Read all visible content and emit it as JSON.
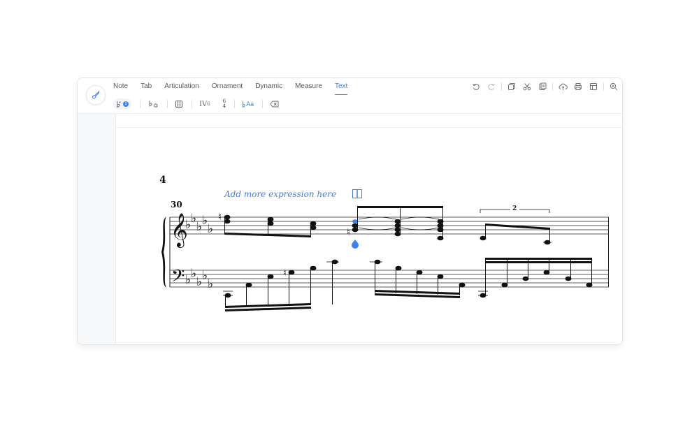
{
  "toolbar": {
    "tabs": [
      {
        "label": "Note"
      },
      {
        "label": "Tab"
      },
      {
        "label": "Articulation"
      },
      {
        "label": "Ornament"
      },
      {
        "label": "Dynamic"
      },
      {
        "label": "Measure"
      },
      {
        "label": "Text"
      }
    ],
    "active_tab": "Text",
    "tools": {
      "badge_count": "1",
      "roman_numeral": "IV",
      "roman_superscript": "6",
      "figured_top": "6",
      "figured_bottom": "4",
      "text_style_label": "Aa"
    }
  },
  "score": {
    "system_number": "4",
    "measure_number": "30",
    "expression_placeholder": "Add more expression here",
    "tuplet_number": "2"
  },
  "colors": {
    "accent": "#3b82f6",
    "expression": "#4a7fd6"
  }
}
